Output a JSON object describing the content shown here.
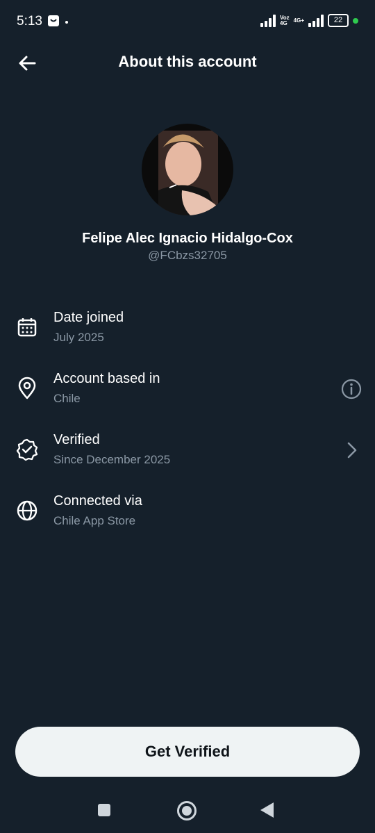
{
  "status_bar": {
    "time": "5:13",
    "net_label_1": "Voz\n4G",
    "net_label_2": "4G+",
    "battery": "22"
  },
  "header": {
    "title": "About this account"
  },
  "profile": {
    "name": "Felipe Alec Ignacio Hidalgo-Cox",
    "handle": "@FCbzs32705"
  },
  "rows": [
    {
      "title": "Date joined",
      "subtitle": "July 2025",
      "icon": "calendar-icon"
    },
    {
      "title": "Account based in",
      "subtitle": "Chile",
      "icon": "location-pin-icon",
      "action_icon": "info-icon"
    },
    {
      "title": "Verified",
      "subtitle": "Since December 2025",
      "icon": "verified-badge-icon",
      "action_icon": "chevron-right-icon"
    },
    {
      "title": "Connected via",
      "subtitle": "Chile App Store",
      "icon": "globe-icon"
    }
  ],
  "cta": {
    "label": "Get Verified"
  },
  "colors": {
    "background": "#15202b",
    "secondary_text": "#8b98a5",
    "button_bg": "#eff3f4",
    "battery_dot": "#2fca4f"
  }
}
